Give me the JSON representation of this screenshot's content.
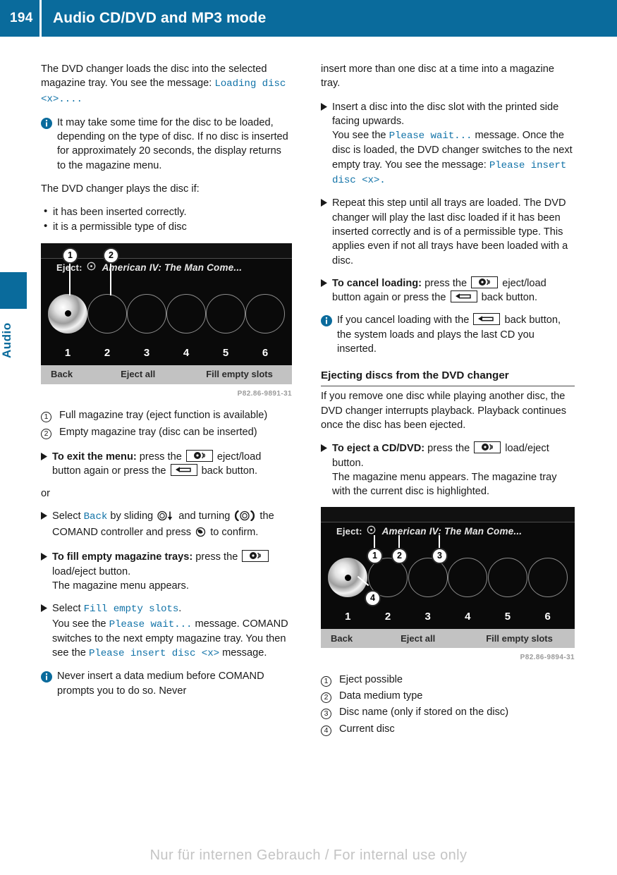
{
  "header": {
    "page_number": "194",
    "title": "Audio CD/DVD and MP3 mode"
  },
  "side_tab": {
    "label": "Audio"
  },
  "colors": {
    "brand_blue": "#0a6b9c",
    "display_text_blue": "#1273a8",
    "watermark_gray": "#c4c4c4"
  },
  "left_column": {
    "intro_p1": "The DVD changer loads the disc into the selected magazine tray. You see the message: ",
    "intro_p1_display": "Loading disc <x>....",
    "note1": "It may take some time for the disc to be loaded, depending on the type of disc. If no disc is inserted for approximately 20 seconds, the display returns to the magazine menu.",
    "plays_if_lead": "The DVD changer plays the disc if:",
    "plays_if_items": [
      "it has been inserted correctly.",
      "it is a permissible type of disc"
    ],
    "figure1": {
      "status_title": "American IV: The Man Come...",
      "eject_label": "Eject:",
      "trays": [
        "1",
        "2",
        "3",
        "4",
        "5",
        "6"
      ],
      "filled_tray_index": 0,
      "softkeys": [
        "Back",
        "Eject all",
        "Fill empty slots"
      ],
      "bubbles": [
        "1",
        "2"
      ],
      "figure_id": "P82.86-9891-31"
    },
    "callouts": [
      {
        "num": "1",
        "text": "Full magazine tray (eject function is available)"
      },
      {
        "num": "2",
        "text": "Empty magazine tray (disc can be inserted)"
      }
    ],
    "step_exit_bold": "To exit the menu:",
    "step_exit_t1": " press the ",
    "step_exit_t2": " eject/load button again or press the ",
    "step_exit_t3": " back button.",
    "or_label": "or",
    "step_select_back_t1": "Select ",
    "step_select_back_display": "Back",
    "step_select_back_t2": " by sliding ",
    "step_select_back_t3": " and turning ",
    "step_select_back_t4": " the COMAND controller and press ",
    "step_select_back_t5": " to confirm.",
    "step_fill_bold": "To fill empty magazine trays:",
    "step_fill_t1": " press the ",
    "step_fill_t2": " load/eject button.",
    "step_fill_t3": "The magazine menu appears.",
    "step_select_fill_t1": "Select ",
    "step_select_fill_display": "Fill empty slots",
    "step_select_fill_t2": ".",
    "step_select_fill_t3": "You see the ",
    "step_select_fill_display2": "Please wait...",
    "step_select_fill_t4": " message. COMAND switches to the next empty magazine tray. You then see the ",
    "step_select_fill_display3": "Please insert disc <x>",
    "step_select_fill_t5": " message.",
    "note2": "Never insert a data medium before COMAND prompts you to do so. Never"
  },
  "right_column": {
    "note_continued": "insert more than one disc at a time into a magazine tray.",
    "step_insert_t1": "Insert a disc into the disc slot with the printed side facing upwards.",
    "step_insert_t2": "You see the ",
    "step_insert_display1": "Please wait...",
    "step_insert_t3": " message. Once the disc is loaded, the DVD changer switches to the next empty tray. You see the message: ",
    "step_insert_display2": "Please insert disc <x>.",
    "step_repeat": "Repeat this step until all trays are loaded. The DVD changer will play the last disc loaded if it has been inserted correctly and is of a permissible type. This applies even if not all trays have been loaded with a disc.",
    "step_cancel_bold": "To cancel loading:",
    "step_cancel_t1": " press the ",
    "step_cancel_t2": " eject/load button again or press the ",
    "step_cancel_t3": " back button.",
    "note3_t1": "If you cancel loading with the ",
    "note3_t2": " back button, the system loads and plays the last CD you inserted.",
    "section_heading": "Ejecting discs from the DVD changer",
    "eject_para": "If you remove one disc while playing another disc, the DVD changer interrupts playback. Playback continues once the disc has been ejected.",
    "step_eject_bold": "To eject a CD/DVD:",
    "step_eject_t1": " press the ",
    "step_eject_t2": " load/eject button.",
    "step_eject_t3": "The magazine menu appears. The magazine tray with the current disc is highlighted.",
    "figure2": {
      "eject_label": "Eject:",
      "status_title": "American IV: The Man Come...",
      "trays": [
        "1",
        "2",
        "3",
        "4",
        "5",
        "6"
      ],
      "filled_tray_index": 0,
      "softkeys": [
        "Back",
        "Eject all",
        "Fill empty slots"
      ],
      "bubbles": [
        "1",
        "2",
        "3",
        "4"
      ],
      "figure_id": "P82.86-9894-31"
    },
    "callouts": [
      {
        "num": "1",
        "text": "Eject possible"
      },
      {
        "num": "2",
        "text": "Data medium type"
      },
      {
        "num": "3",
        "text": "Disc name (only if stored on the disc)"
      },
      {
        "num": "4",
        "text": "Current disc"
      }
    ]
  },
  "footer": {
    "watermark": "Nur für internen Gebrauch / For internal use only"
  },
  "icons": {
    "info": "info-circle-icon",
    "eject_load_button": "eject-load-button-icon",
    "back_button": "back-button-icon",
    "controller_slide_down": "controller-slide-down-icon",
    "controller_turn": "controller-turn-icon",
    "controller_press": "controller-press-icon",
    "step_arrow": "step-arrow-icon"
  }
}
